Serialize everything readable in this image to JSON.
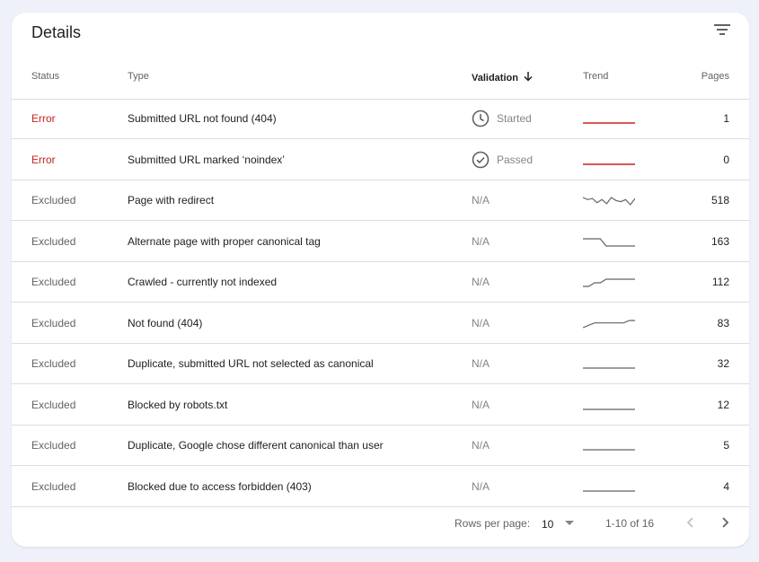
{
  "header": {
    "title": "Details",
    "filter_icon": "filter-icon"
  },
  "columns": {
    "status": "Status",
    "type": "Type",
    "validation": "Validation",
    "trend": "Trend",
    "pages": "Pages"
  },
  "rows": [
    {
      "status": "Error",
      "type": "Submitted URL not found (404)",
      "validation": "Started",
      "validation_icon": "clock-icon",
      "pages": "1",
      "trend": [
        1,
        1,
        1,
        1,
        1,
        1,
        1,
        1,
        1,
        1
      ]
    },
    {
      "status": "Error",
      "type": "Submitted URL marked ‘noindex’",
      "validation": "Passed",
      "validation_icon": "check-circle-icon",
      "pages": "0",
      "trend": [
        0,
        0,
        0,
        0,
        0,
        0,
        0,
        0,
        0,
        0
      ]
    },
    {
      "status": "Excluded",
      "type": "Page with redirect",
      "validation": "N/A",
      "pages": "518",
      "trend": [
        520,
        518,
        519,
        515,
        518,
        514,
        520,
        517,
        516,
        518,
        513,
        519
      ]
    },
    {
      "status": "Excluded",
      "type": "Alternate page with proper canonical tag",
      "validation": "N/A",
      "pages": "163",
      "trend": [
        165,
        165,
        165,
        165,
        163,
        163,
        163,
        163,
        163,
        163
      ]
    },
    {
      "status": "Excluded",
      "type": "Crawled - currently not indexed",
      "validation": "N/A",
      "pages": "112",
      "trend": [
        110,
        110,
        111,
        111,
        112,
        112,
        112,
        112,
        112,
        112
      ]
    },
    {
      "status": "Excluded",
      "type": "Not found (404)",
      "validation": "N/A",
      "pages": "83",
      "trend": [
        80,
        81,
        82,
        82,
        82,
        82,
        82,
        82,
        83,
        83
      ]
    },
    {
      "status": "Excluded",
      "type": "Duplicate, submitted URL not selected as canonical",
      "validation": "N/A",
      "pages": "32",
      "trend": [
        32,
        32,
        32,
        32,
        32,
        32,
        32,
        32,
        32,
        32
      ]
    },
    {
      "status": "Excluded",
      "type": "Blocked by robots.txt",
      "validation": "N/A",
      "pages": "12",
      "trend": [
        12,
        12,
        12,
        12,
        12,
        12,
        12,
        12,
        12,
        12
      ]
    },
    {
      "status": "Excluded",
      "type": "Duplicate, Google chose different canonical than user",
      "validation": "N/A",
      "pages": "5",
      "trend": [
        5,
        5,
        5,
        5,
        5,
        5,
        5,
        5,
        5,
        5
      ]
    },
    {
      "status": "Excluded",
      "type": "Blocked due to access forbidden (403)",
      "validation": "N/A",
      "pages": "4",
      "trend": [
        4,
        4,
        4,
        4,
        4,
        4,
        4,
        4,
        4,
        4
      ]
    }
  ],
  "colors": {
    "error": "#c5221f",
    "trend_error": "#c5221f",
    "trend_neutral": "#5f6368"
  },
  "pagination": {
    "rows_per_page_label": "Rows per page:",
    "rows_per_page_value": "10",
    "range": "1-10 of 16",
    "prev_icon": "chevron-left-icon",
    "next_icon": "chevron-right-icon"
  }
}
